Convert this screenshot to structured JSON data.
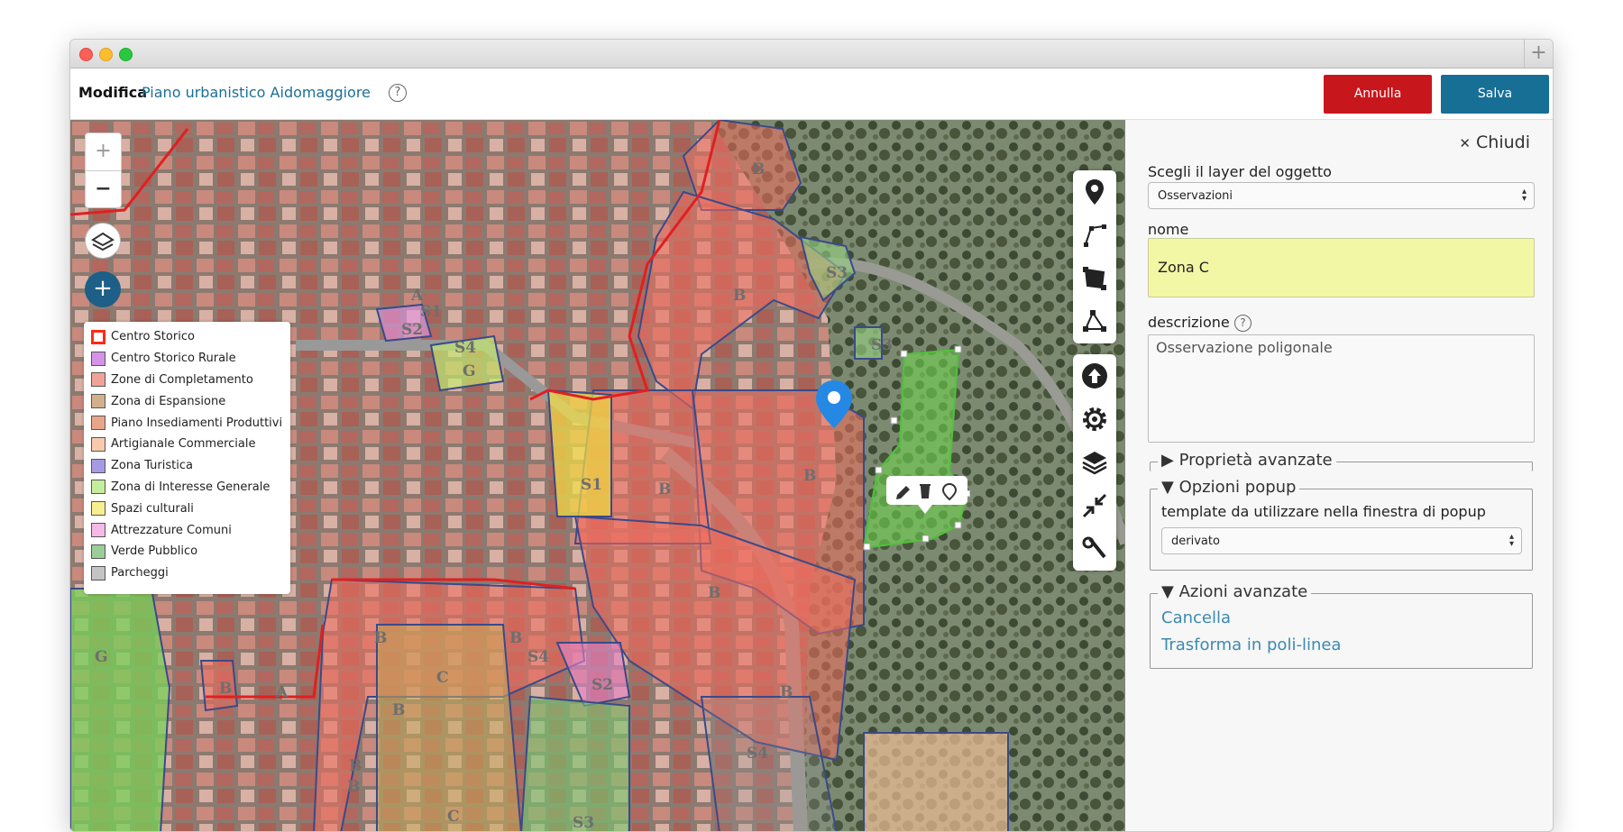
{
  "colors": {
    "cancel_button": "#c8161d",
    "save_button": "#176f96",
    "accent_link": "#3b8ab0",
    "input_highlight": "#f2f7a6"
  },
  "header": {
    "title_bold": "Modifica",
    "title_name": "Piano urbanistico Aidomaggiore",
    "help_icon": "question-circle-icon",
    "cancel_label": "Annulla",
    "save_label": "Salva"
  },
  "map": {
    "zoom_in": "+",
    "zoom_out": "−",
    "add_button": "+",
    "legend": [
      {
        "label": "Centro Storico",
        "color": "#ff4a2e"
      },
      {
        "label": "Centro Storico Rurale",
        "color": "#d493e8"
      },
      {
        "label": "Zone di Completamento",
        "color": "#f1a298"
      },
      {
        "label": "Zona di Espansione",
        "color": "#d3b08c"
      },
      {
        "label": "Piano Insediamenti Produttivi",
        "color": "#e9a58a"
      },
      {
        "label": "Artigianale Commerciale",
        "color": "#f7c9ad"
      },
      {
        "label": "Zona Turistica",
        "color": "#a69ae2"
      },
      {
        "label": "Zona di Interesse Generale",
        "color": "#c5ee9c"
      },
      {
        "label": "Spazi culturali",
        "color": "#f7ee8d"
      },
      {
        "label": "Attrezzature Comuni",
        "color": "#f5b9e7"
      },
      {
        "label": "Verde Pubblico",
        "color": "#9ccc97"
      },
      {
        "label": "Parcheggi",
        "color": "#c4c4c4"
      }
    ],
    "zone_labels": [
      "B",
      "B",
      "S3",
      "S3",
      "B",
      "B",
      "S1",
      "B",
      "B",
      "B",
      "B",
      "B",
      "C",
      "C",
      "S4",
      "S2",
      "S4",
      "S3",
      "A",
      "A",
      "S1",
      "S2",
      "S4",
      "G",
      "G",
      "B",
      "B",
      "B"
    ]
  },
  "panel": {
    "close_label": "Chiudi",
    "layer_label": "Scegli il layer del oggetto",
    "layer_value": "Osservazioni",
    "nome_label": "nome",
    "nome_value": "Zona C",
    "descrizione_label": "descrizione",
    "descrizione_value": "Osservazione poligonale",
    "proprieta_label": "Proprietà avanzate",
    "popup_label": "Opzioni popup",
    "popup_template_label": "template da utilizzare nella finestra di popup",
    "popup_template_value": "derivato",
    "azioni_label": "Azioni avanzate",
    "cancella_label": "Cancella",
    "trasforma_label": "Trasforma in poli-linea"
  }
}
